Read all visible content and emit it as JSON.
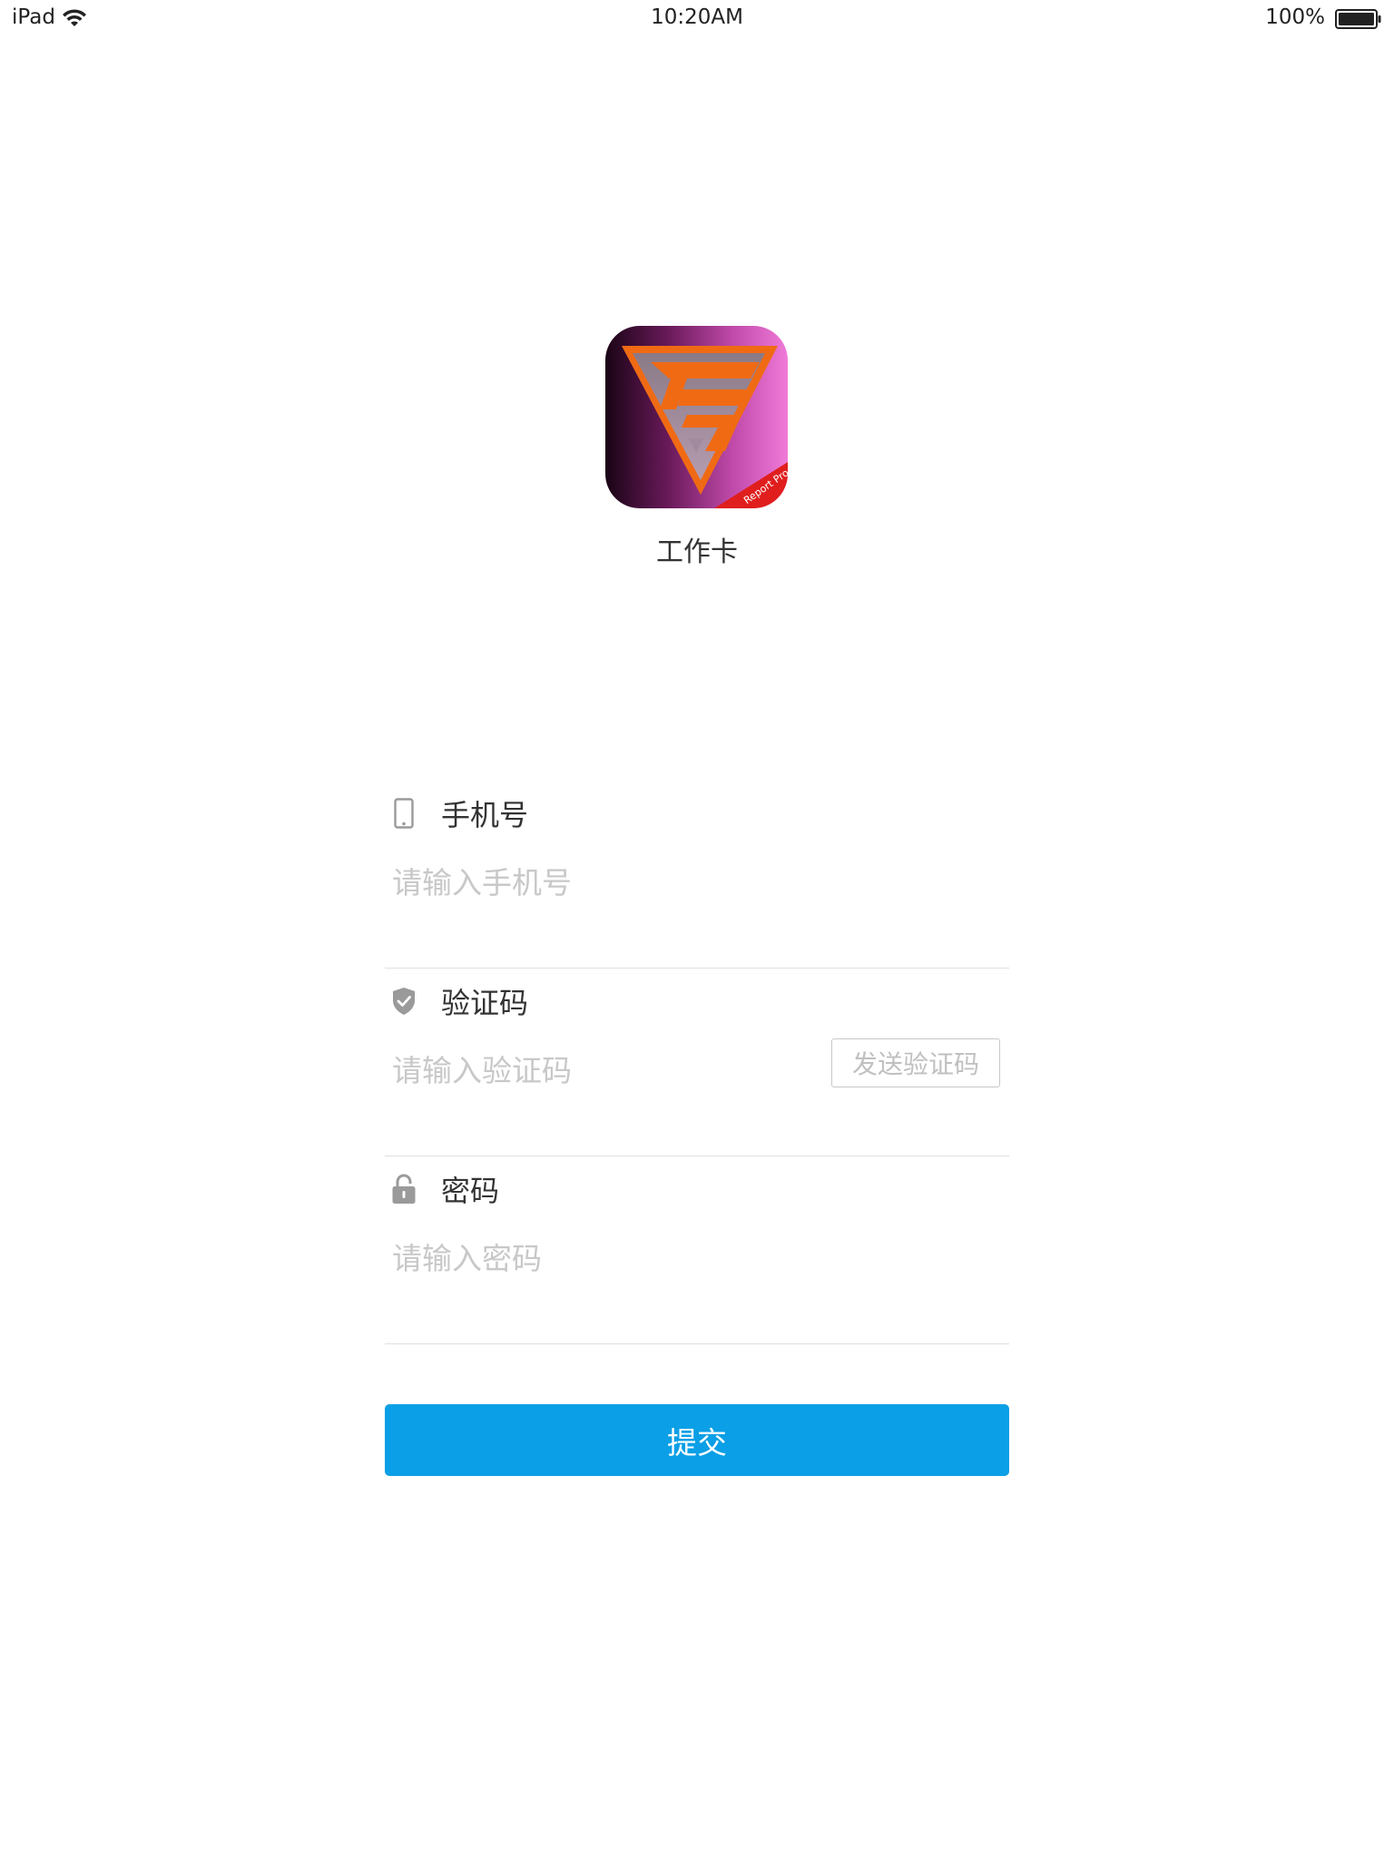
{
  "status_bar": {
    "device": "iPad",
    "time": "10:20AM",
    "battery_pct": "100%"
  },
  "app": {
    "name": "工作卡",
    "icon_ribbon_text": "Report Pro"
  },
  "form": {
    "phone": {
      "label": "手机号",
      "placeholder": "请输入手机号",
      "icon": "phone-icon"
    },
    "code": {
      "label": "验证码",
      "placeholder": "请输入验证码",
      "icon": "shield-check-icon",
      "send_button_label": "发送验证码"
    },
    "password": {
      "label": "密码",
      "placeholder": "请输入密码",
      "icon": "lock-icon"
    },
    "submit_label": "提交"
  },
  "colors": {
    "primary": "#0a9fe6",
    "placeholder": "#c8c8c8",
    "divider": "#e0e0e0",
    "icon_gray": "#9a9a9a"
  }
}
